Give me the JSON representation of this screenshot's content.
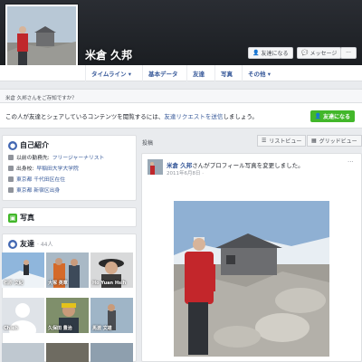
{
  "profile": {
    "name": "米倉 久邦",
    "add_friend": "友達になる",
    "message": "メッセージ",
    "more": "···"
  },
  "tabs": [
    {
      "label": "タイムライン ▾"
    },
    {
      "label": "基本データ"
    },
    {
      "label": "友達"
    },
    {
      "label": "写真"
    },
    {
      "label": "その他 ▾"
    }
  ],
  "notice": {
    "heading": "米倉 久邦さんをご存知ですか？",
    "text_before": "この人が友達とシェアしているコンテンツを閲覧するには、",
    "link": "友達リクエストを送信",
    "text_after": "しましょう。",
    "button": "友達になる"
  },
  "intro": {
    "title": "自己紹介",
    "rows": [
      {
        "prefix": "以前の勤務先:",
        "link": "フリージャーナリスト"
      },
      {
        "prefix": "出身校:",
        "link": "早稲田大学大学院"
      },
      {
        "prefix": "",
        "link": "東京都 千代田区在住"
      },
      {
        "prefix": "",
        "link": "東京都 新宿区出身"
      }
    ]
  },
  "photos": {
    "title": "写真"
  },
  "friends": {
    "title": "友達",
    "count": "· 44人",
    "items": [
      {
        "name": "石原 文紀"
      },
      {
        "name": "大塚 英章"
      },
      {
        "name": "Ho Yuan Hsih"
      },
      {
        "name": "Chieh"
      },
      {
        "name": "久保田 豊治"
      },
      {
        "name": "馬渡 文雄"
      }
    ]
  },
  "timeline": {
    "section_label": "投稿",
    "list_view": "リストビュー",
    "grid_view": "グリッドビュー",
    "post": {
      "author": "米倉 久邦",
      "action": "さんがプロフィール写真を変更しました。",
      "date": "2011年6月8日 ·",
      "more": "···"
    }
  }
}
